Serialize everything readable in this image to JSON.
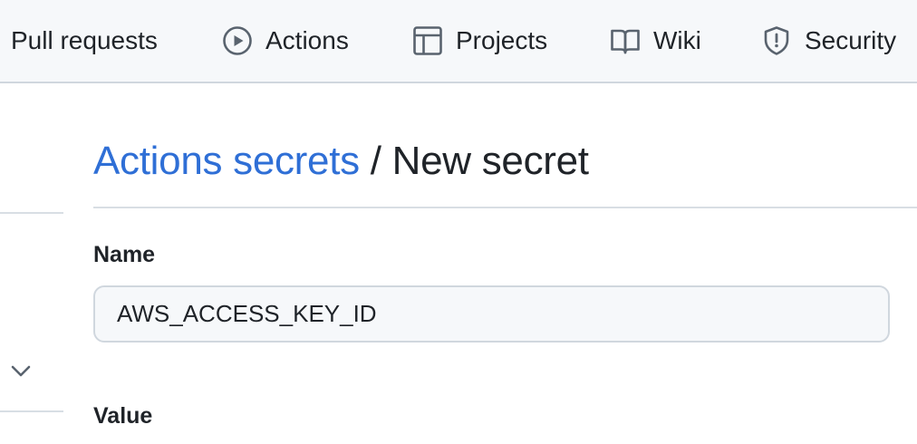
{
  "nav": {
    "pull_requests": "Pull requests",
    "actions": "Actions",
    "projects": "Projects",
    "wiki": "Wiki",
    "security": "Security"
  },
  "breadcrumb": {
    "parent": "Actions secrets",
    "separator": "/",
    "current": "New secret"
  },
  "form": {
    "name_label": "Name",
    "name_value": "AWS_ACCESS_KEY_ID",
    "value_label": "Value"
  },
  "colors": {
    "link": "#2f6fd6",
    "nav_bg": "#f6f8fa",
    "border": "#d0d7de"
  },
  "icons": [
    "play-circle-icon",
    "table-icon",
    "book-icon",
    "shield-icon",
    "chevron-down-icon"
  ]
}
